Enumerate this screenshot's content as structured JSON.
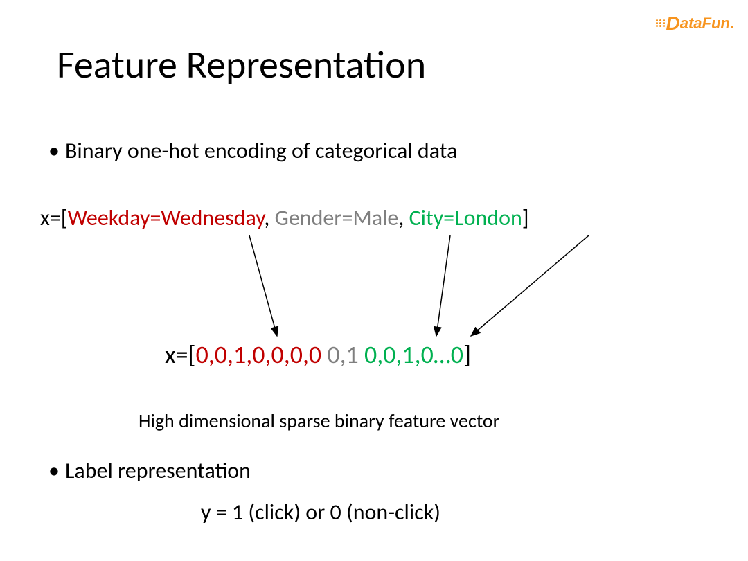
{
  "logo": {
    "text": "DataFun."
  },
  "title": "Feature Representation",
  "bullet1": "Binary one-hot encoding of categorical data",
  "example": {
    "prefix": "x=[",
    "weekday": "Weekday=Wednesday",
    "sep1": ", ",
    "gender": "Gender=Male",
    "sep2": ", ",
    "city": "City=London",
    "suffix": "]"
  },
  "vector": {
    "prefix": "x=[",
    "red": "0,0,1,0,0,0,0",
    "space1": "  ",
    "gray": "0,1",
    "space2": "  ",
    "green": "0,0,1,0…0",
    "suffix": "]"
  },
  "caption": "High dimensional sparse binary feature vector",
  "bullet2": "Label representation",
  "label_line": "y = 1 (click) or 0 (non-click)"
}
